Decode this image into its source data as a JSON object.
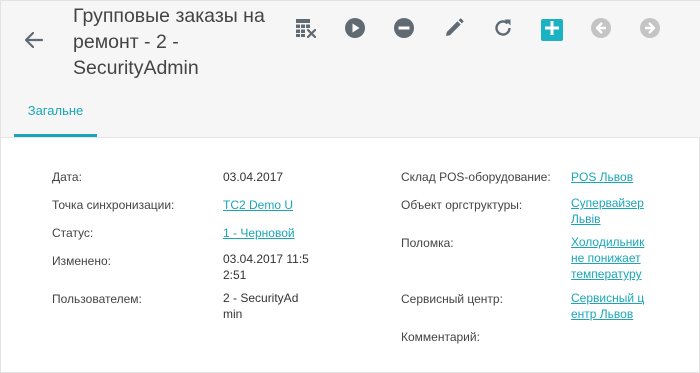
{
  "header": {
    "title": "Групповые заказы на ремонт - 2 - SecurityAdmin",
    "toolbar": {
      "grid_icon": "table-remove-icon",
      "play_icon": "play-circle-icon",
      "minus_icon": "minus-circle-icon",
      "edit_icon": "pencil-icon",
      "refresh_icon": "refresh-icon",
      "add_icon": "plus-square-icon",
      "prev_icon": "arrow-left-circle-icon",
      "next_icon": "arrow-right-circle-icon"
    }
  },
  "tabs": [
    {
      "label": "Загальне",
      "active": true
    }
  ],
  "fields_left": [
    {
      "label": "Дата:",
      "value": "03.04.2017",
      "link": false
    },
    {
      "label": "Точка синхронизации:",
      "value": "TC2 Demo U",
      "link": true
    },
    {
      "label": "Статус:",
      "value": "1 - Черновой",
      "link": true
    },
    {
      "label": "Изменено:",
      "value": "03.04.2017 11:52:51",
      "link": false
    },
    {
      "label": "Пользователем:",
      "value": "2 - SecurityAdmin",
      "link": false
    }
  ],
  "fields_right": [
    {
      "label": "Склад POS-оборудование:",
      "value": "POS Львов",
      "link": true
    },
    {
      "label": "Объект оргструктуры:",
      "value": "Супервайзер Львів",
      "link": true
    },
    {
      "label": "Поломка:",
      "value": "Холодильник не понижает температуру",
      "link": true
    },
    {
      "label": "Сервисный центр:",
      "value": "Сервисный центр Львов",
      "link": true
    },
    {
      "label": "Комментарий:",
      "value": "",
      "link": false
    }
  ],
  "colors": {
    "accent": "#1aa6b7",
    "header_bg": "#f6f6f6",
    "icon_gray": "#5f6a72",
    "icon_disabled": "#c4c4c4"
  }
}
